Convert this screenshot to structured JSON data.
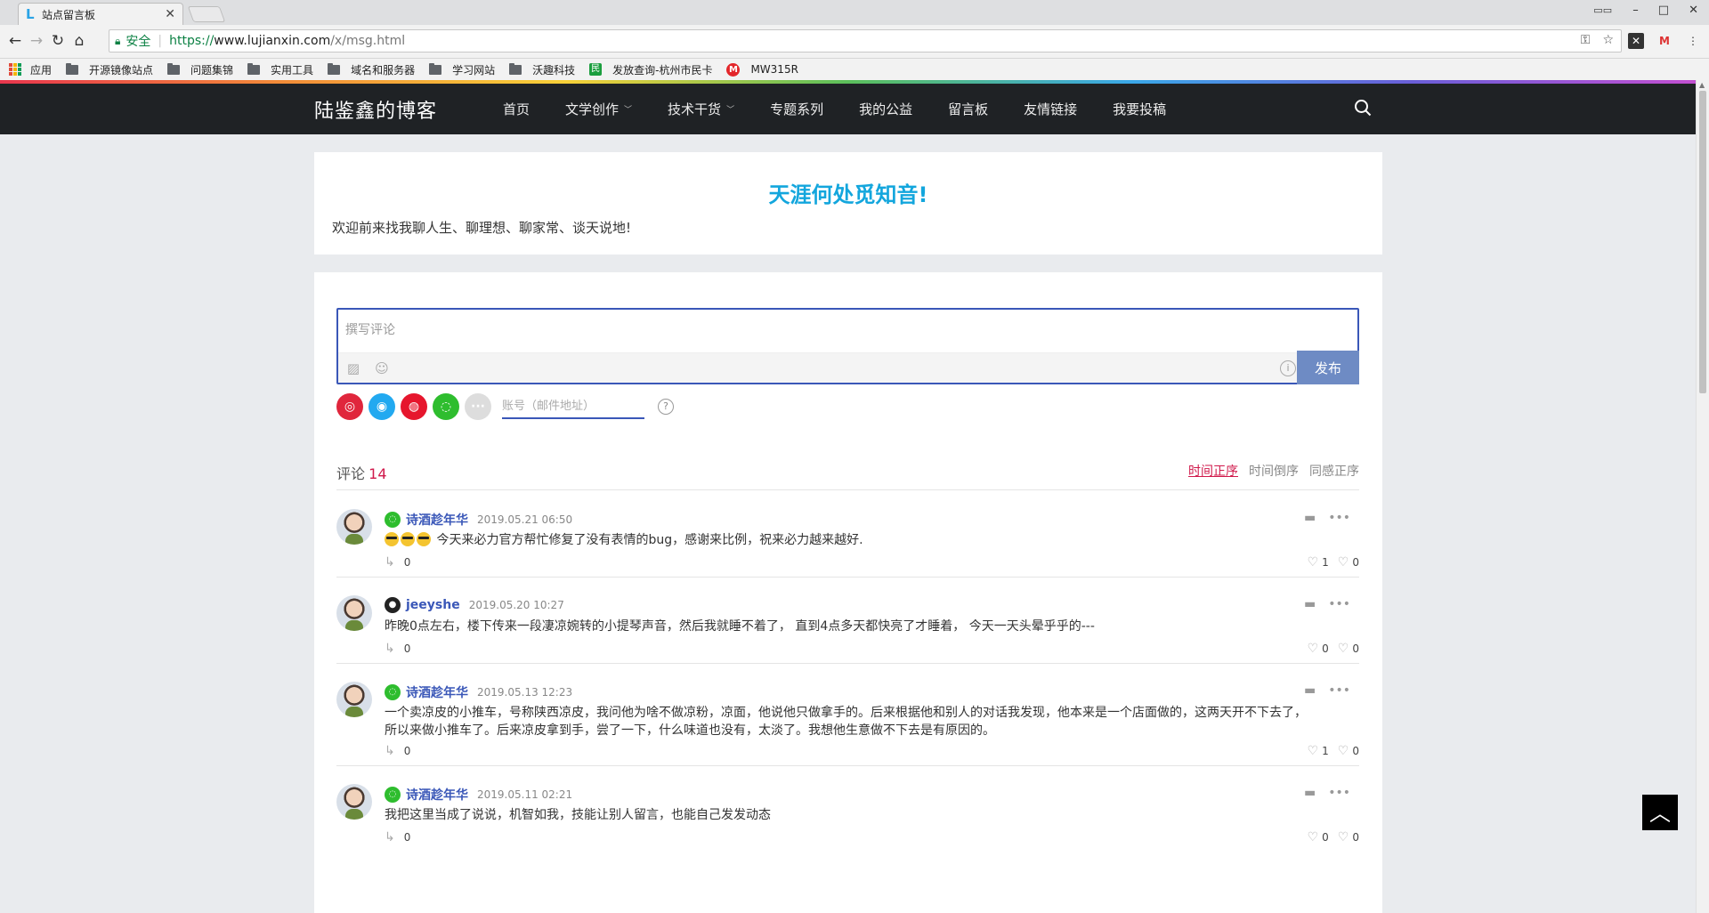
{
  "browser": {
    "tab_title": "站点留言板",
    "tab_favicon": "L",
    "security_label": "安全",
    "url_proto": "https://",
    "url_host": "www.lujianxin.com",
    "url_path": "/x/msg.html"
  },
  "bookmarks": {
    "apps_label": "应用",
    "items": [
      "开源镜像站点",
      "问题集锦",
      "实用工具",
      "域名和服务器",
      "学习网站",
      "沃趣科技"
    ],
    "green_item": "发放查询-杭州市民卡",
    "red_item": "MW315R"
  },
  "site": {
    "logo": "陆鉴鑫的博客",
    "nav": [
      "首页",
      "文学创作",
      "技术干货",
      "专题系列",
      "我的公益",
      "留言板",
      "友情链接",
      "我要投稿"
    ]
  },
  "intro": {
    "title": "天涯何处觅知音!",
    "text": "欢迎前来找我聊人生、聊理想、聊家常、谈天说地!"
  },
  "comment_form": {
    "placeholder": "撰写评论",
    "publish_label": "发布",
    "account_placeholder": "账号（邮件地址）"
  },
  "comments_header": {
    "label": "评论",
    "count": "14",
    "sort_asc": "时间正序",
    "sort_desc": "时间倒序",
    "sort_likes": "同感正序"
  },
  "comments": [
    {
      "author": "诗酒趁年华",
      "time": "2019.05.21 06:50",
      "text": "今天来必力官方帮忙修复了没有表情的bug，感谢来比例，祝来必力越来越好.",
      "replies": "0",
      "likes": "1",
      "dislikes": "0"
    },
    {
      "author": "jeeyshe",
      "time": "2019.05.20 10:27",
      "text": "昨晚0点左右，楼下传来一段凄凉婉转的小提琴声音，然后我就睡不着了， 直到4点多天都快亮了才睡着， 今天一天头晕乎乎的---",
      "replies": "0",
      "likes": "0",
      "dislikes": "0"
    },
    {
      "author": "诗酒趁年华",
      "time": "2019.05.13 12:23",
      "text_line1": "一个卖凉皮的小推车，号称陕西凉皮，我问他为啥不做凉粉，凉面，他说他只做拿手的。后来根据他和别人的对话我发现，他本来是一个店面做的，这两天开不下去了，",
      "text_line2": "所以来做小推车了。后来凉皮拿到手，尝了一下，什么味道也没有，太淡了。我想他生意做不下去是有原因的。",
      "replies": "0",
      "likes": "1",
      "dislikes": "0"
    },
    {
      "author": "诗酒趁年华",
      "time": "2019.05.11 02:21",
      "text": "我把这里当成了说说，机智如我，技能让别人留言，也能自己发发动态",
      "replies": "0",
      "likes": "0",
      "dislikes": "0"
    }
  ],
  "colors": {
    "header_bg": "#1f2225",
    "accent": "#3a57b8",
    "intro_title": "#13a6dd",
    "highlight": "#d0194b"
  }
}
